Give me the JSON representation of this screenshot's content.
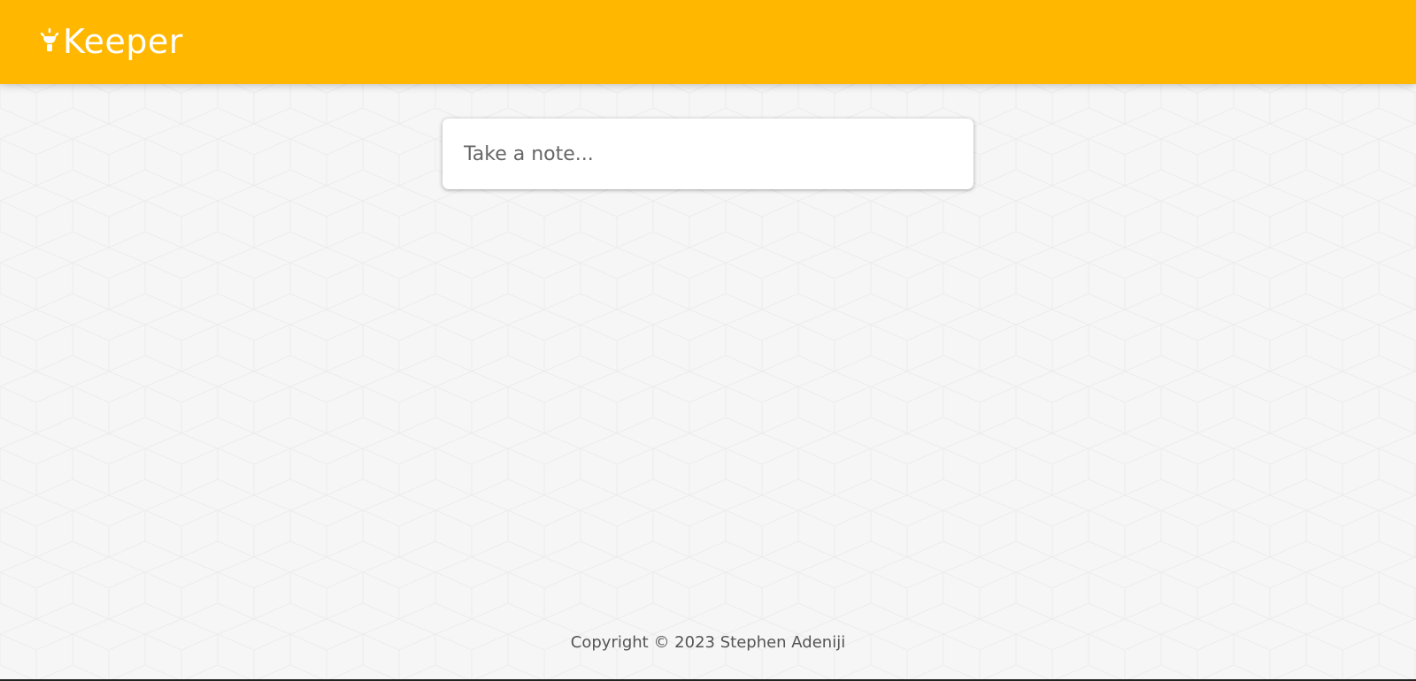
{
  "app": {
    "name": "Keeper",
    "icon": "lightbulb-icon",
    "brand_color": "#ffb700"
  },
  "note_form": {
    "placeholder": "Take a note..."
  },
  "footer": {
    "text": "Copyright © 2023 Stephen Adeniji"
  }
}
